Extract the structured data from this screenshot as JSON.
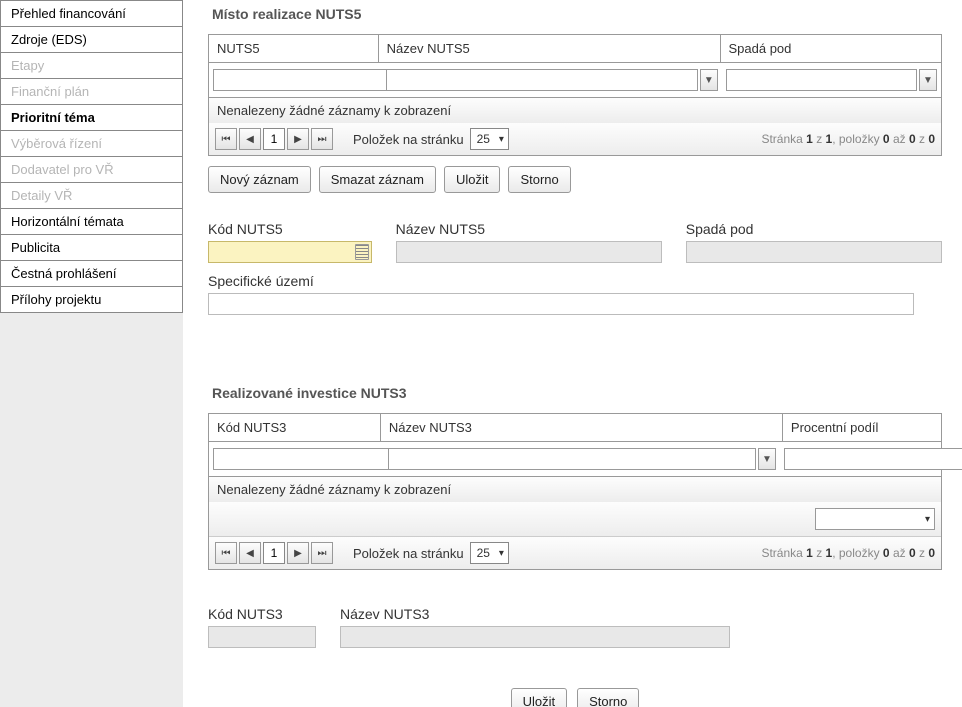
{
  "sidebar": {
    "items": [
      {
        "label": "Přehled financování",
        "enabled": true
      },
      {
        "label": "Zdroje (EDS)",
        "enabled": true
      },
      {
        "label": "Etapy",
        "enabled": false
      },
      {
        "label": "Finanční plán",
        "enabled": false
      },
      {
        "label": "Prioritní téma",
        "enabled": true,
        "selected": true
      },
      {
        "label": "Výběrová řízení",
        "enabled": false
      },
      {
        "label": "Dodavatel pro VŘ",
        "enabled": false
      },
      {
        "label": "Detaily VŘ",
        "enabled": false
      },
      {
        "label": "Horizontální témata",
        "enabled": true
      },
      {
        "label": "Publicita",
        "enabled": true
      },
      {
        "label": "Čestná prohlášení",
        "enabled": true
      },
      {
        "label": "Přílohy projektu",
        "enabled": true
      }
    ]
  },
  "section1": {
    "title": "Místo realizace NUTS5",
    "grid": {
      "columns": [
        "NUTS5",
        "Název NUTS5",
        "Spadá pod"
      ],
      "empty_msg": "Nenalezeny žádné záznamy k zobrazení"
    },
    "pager": {
      "page": "1",
      "per_label": "Položek na stránku",
      "per_value": "25",
      "info_prefix": "Stránka ",
      "info_b1": "1",
      "info_mid1": " z ",
      "info_b2": "1",
      "info_mid2": ", položky ",
      "info_b3": "0",
      "info_mid3": " až ",
      "info_b4": "0",
      "info_mid4": " z ",
      "info_b5": "0"
    },
    "buttons": {
      "new": "Nový záznam",
      "delete": "Smazat záznam",
      "save": "Uložit",
      "cancel": "Storno"
    },
    "form": {
      "kod_label": "Kód NUTS5",
      "nazev_label": "Název NUTS5",
      "spada_label": "Spadá pod",
      "spec_label": "Specifické území"
    }
  },
  "section2": {
    "title": "Realizované investice NUTS3",
    "grid": {
      "columns": [
        "Kód NUTS3",
        "Název NUTS3",
        "Procentní podíl"
      ],
      "empty_msg": "Nenalezeny žádné záznamy k zobrazení"
    },
    "pager": {
      "page": "1",
      "per_label": "Položek na stránku",
      "per_value": "25",
      "info_prefix": "Stránka ",
      "info_b1": "1",
      "info_mid1": " z ",
      "info_b2": "1",
      "info_mid2": ", položky ",
      "info_b3": "0",
      "info_mid3": " až ",
      "info_b4": "0",
      "info_mid4": " z ",
      "info_b5": "0"
    },
    "form": {
      "kod_label": "Kód NUTS3",
      "nazev_label": "Název NUTS3"
    }
  },
  "bottom_buttons": {
    "save": "Uložit",
    "cancel": "Storno"
  }
}
